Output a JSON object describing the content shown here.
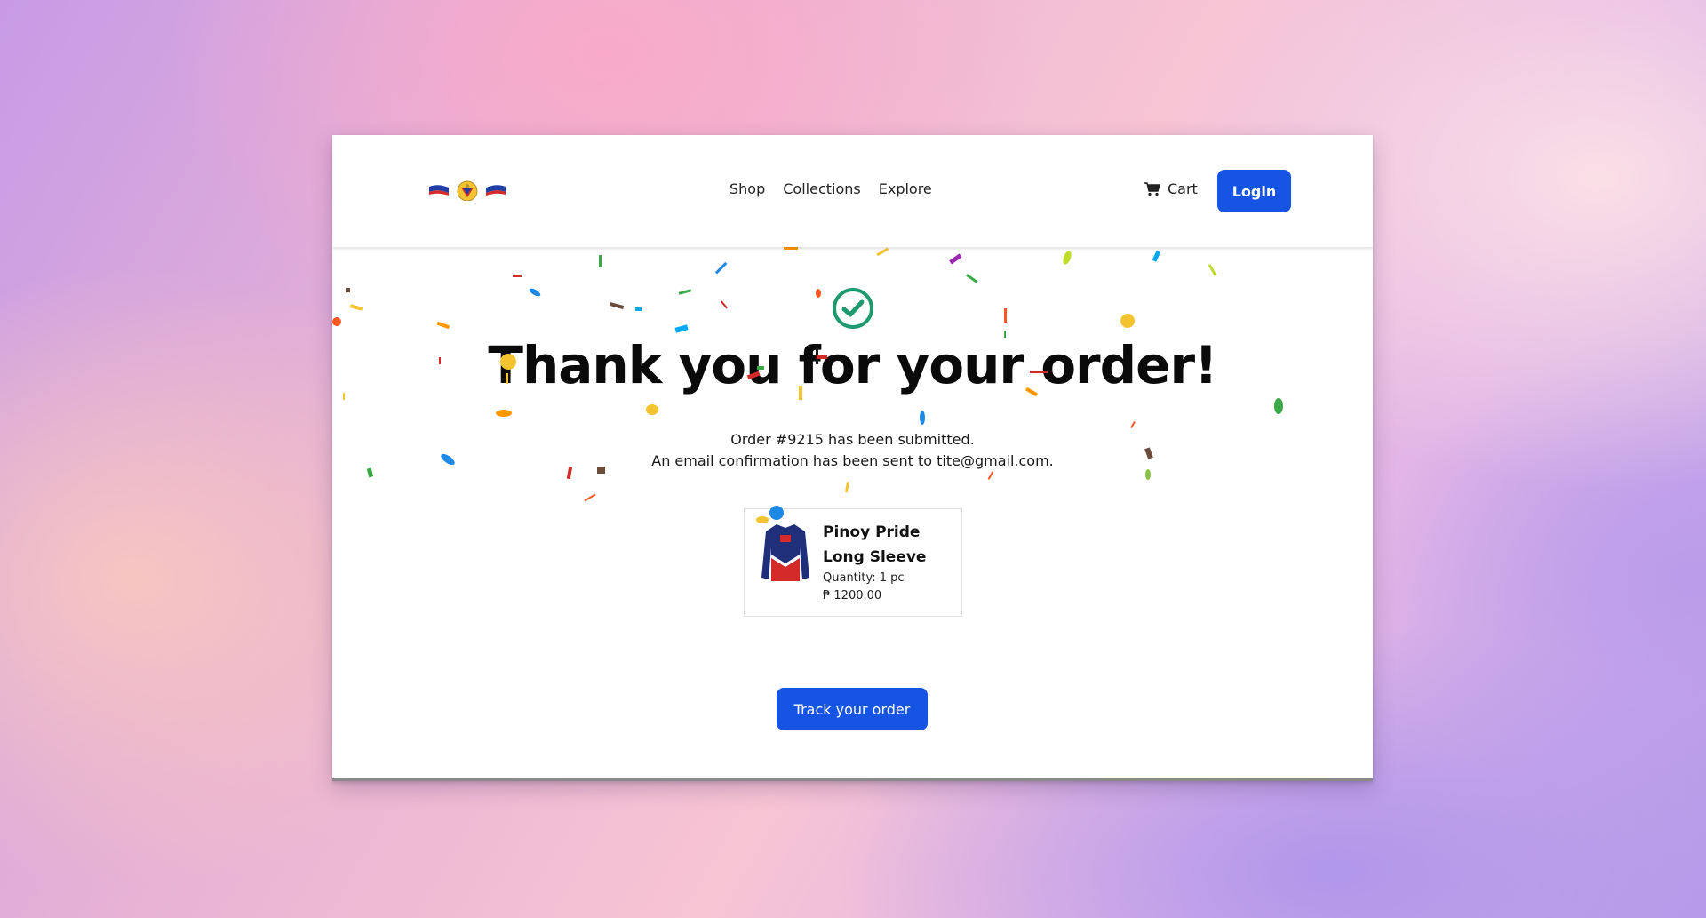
{
  "nav": {
    "links": [
      "Shop",
      "Collections",
      "Explore"
    ],
    "cart_label": "Cart",
    "login_label": "Login"
  },
  "confirmation": {
    "title": "Thank you for your order!",
    "order_line": "Order #9215 has been submitted.",
    "email_line": "An email confirmation has been sent to tite@gmail.com."
  },
  "order_item": {
    "name": "Pinoy Pride Long Sleeve",
    "quantity": "Quantity: 1 pc",
    "price": "₱ 1200.00"
  },
  "actions": {
    "track_label": "Track your order"
  },
  "colors": {
    "accent": "#1654e3",
    "check": "#1e9a6e"
  },
  "icons": [
    "logo",
    "cart-icon",
    "check-circle-icon",
    "product-image"
  ]
}
